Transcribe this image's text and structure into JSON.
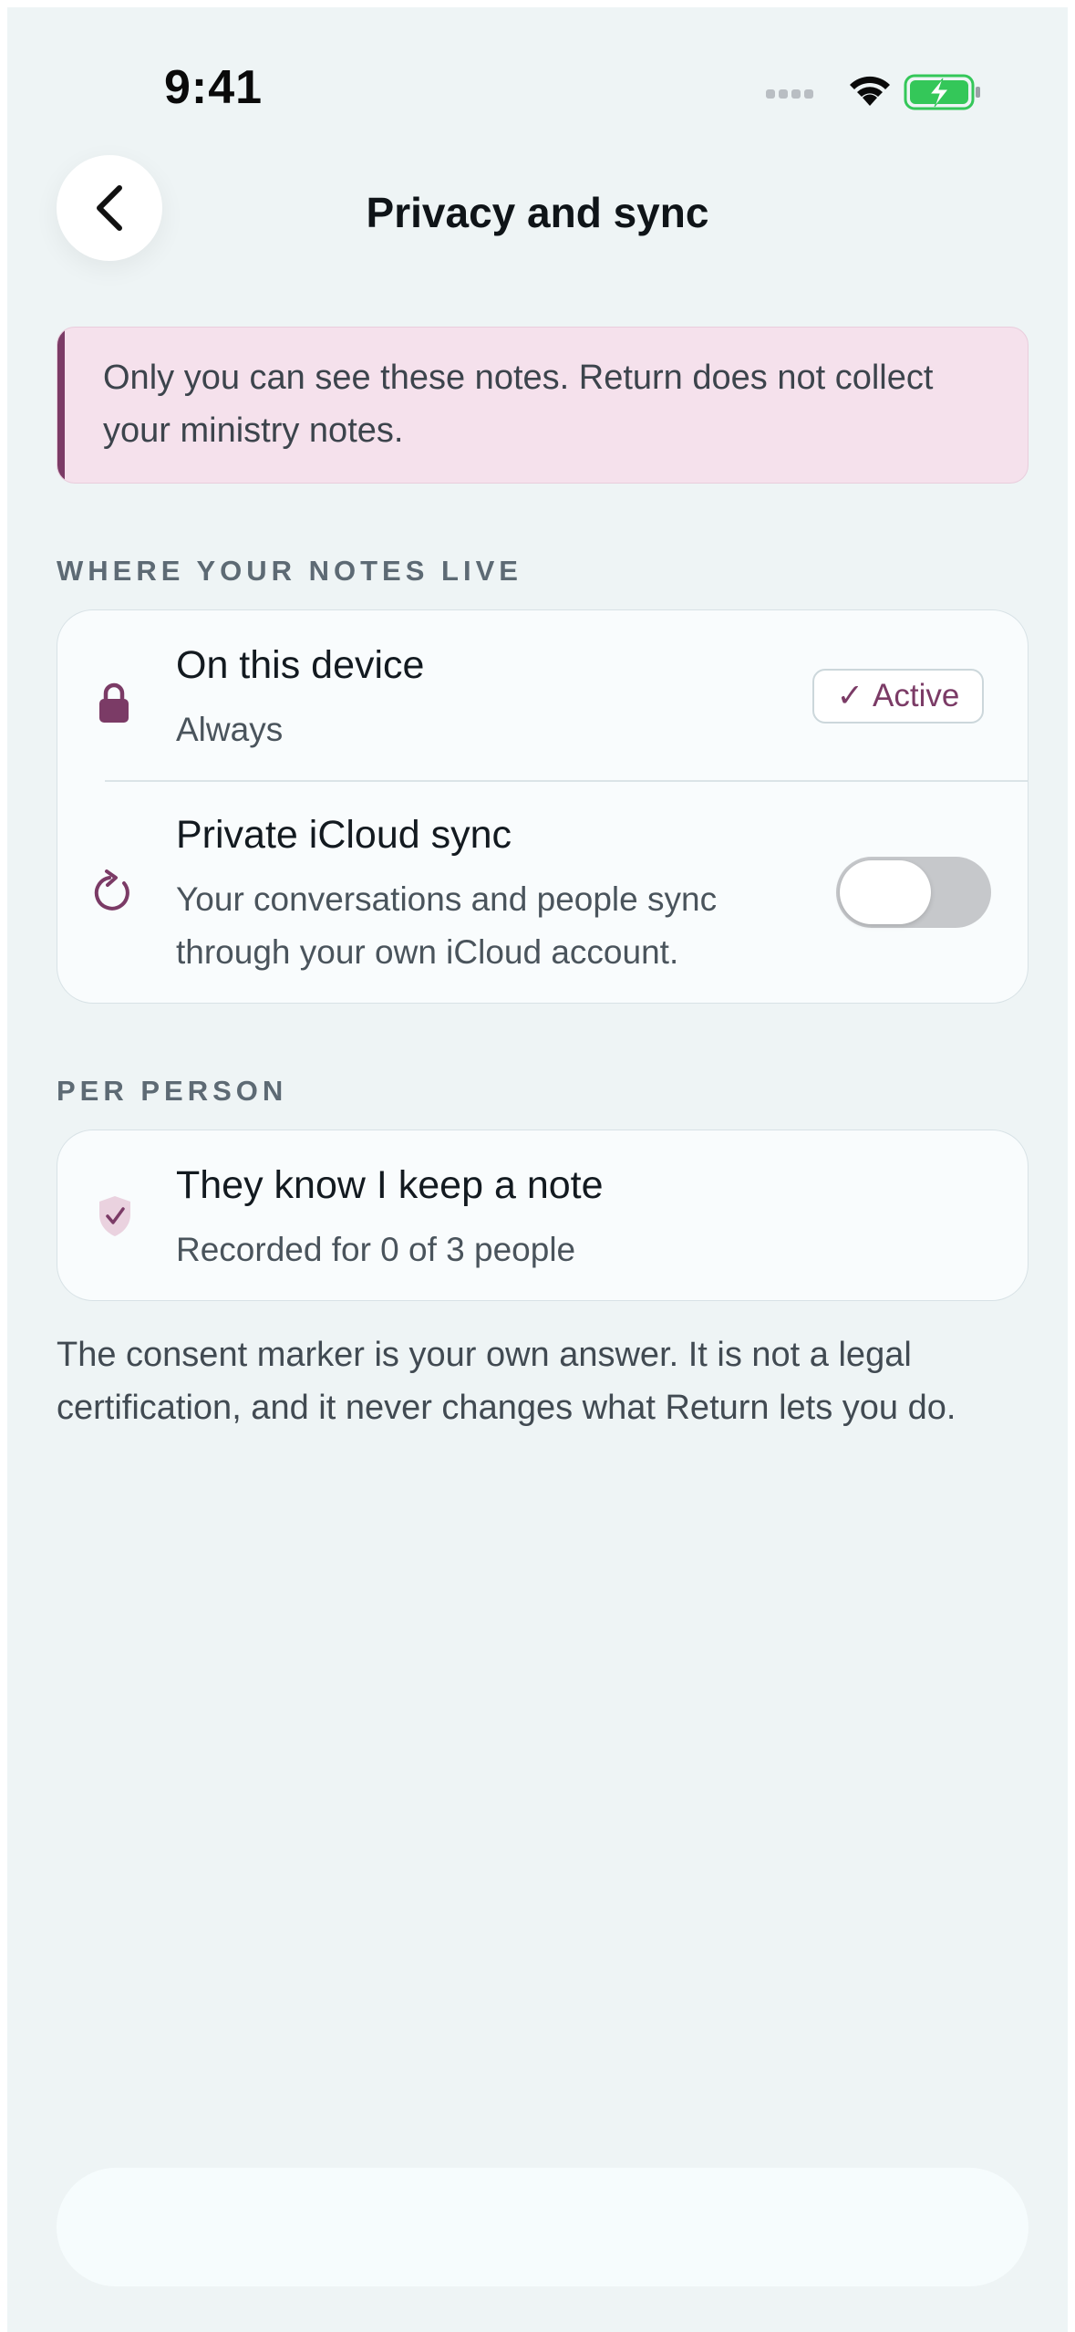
{
  "status_bar": {
    "time": "9:41",
    "signal_icon": "signal-dots-icon",
    "wifi_icon": "wifi-icon",
    "battery_icon": "battery-charging-icon"
  },
  "nav": {
    "back_icon": "chevron-left-icon",
    "title": "Privacy and sync"
  },
  "banner": {
    "text": "Only you can see these notes. Return does not collect your ministry notes."
  },
  "where_section": {
    "label": "WHERE YOUR NOTES LIVE",
    "device_row": {
      "icon": "lock-icon",
      "title": "On this device",
      "subtitle": "Always",
      "badge_check": "✓",
      "badge_label": "Active"
    },
    "icloud_row": {
      "icon": "refresh-icon",
      "title": "Private iCloud sync",
      "subtitle": "Your conversations and people sync through your own iCloud account.",
      "toggle_on": false
    }
  },
  "per_person_section": {
    "label": "PER PERSON",
    "consent_row": {
      "icon": "shield-check-icon",
      "title": "They know I keep a note",
      "subtitle": "Recorded for 0 of 3 people"
    }
  },
  "footnote": "The consent marker is your own answer. It is not a legal certification, and it never changes what Return lets you do.",
  "colors": {
    "accent": "#7b3b66",
    "background": "#eef4f5",
    "banner_bg": "#f5e1ec",
    "card_bg": "#f9fcfd",
    "toggle_off": "#c6c8cb",
    "battery_green": "#34c759"
  }
}
